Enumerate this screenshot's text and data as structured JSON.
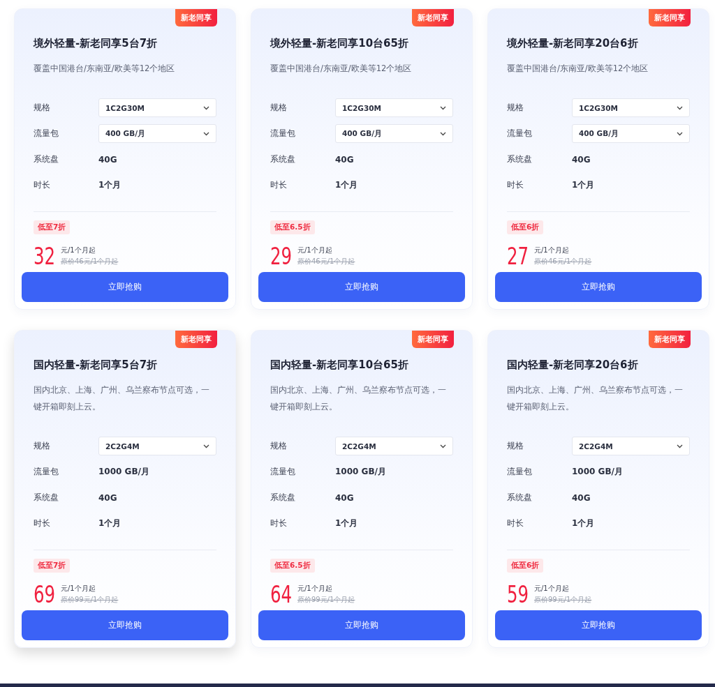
{
  "cards": [
    {
      "badge": "新老同享",
      "title": "境外轻量-新老同享5台7折",
      "description": "覆盖中国港台/东南亚/欧美等12个地区",
      "hovered": false,
      "specs": [
        {
          "label": "规格",
          "kind": "select",
          "value": "1C2G30M"
        },
        {
          "label": "流量包",
          "kind": "select",
          "value": "400 GB/月"
        },
        {
          "label": "系统盘",
          "kind": "text",
          "value": "40G"
        },
        {
          "label": "时长",
          "kind": "text",
          "value": "1个月"
        }
      ],
      "discount": "低至7折",
      "price": "32",
      "unit": "元/1个月起",
      "original": "原价46元/1个月起",
      "button": "立即抢购"
    },
    {
      "badge": "新老同享",
      "title": "境外轻量-新老同享10台65折",
      "description": "覆盖中国港台/东南亚/欧美等12个地区",
      "hovered": false,
      "specs": [
        {
          "label": "规格",
          "kind": "select",
          "value": "1C2G30M"
        },
        {
          "label": "流量包",
          "kind": "select",
          "value": "400 GB/月"
        },
        {
          "label": "系统盘",
          "kind": "text",
          "value": "40G"
        },
        {
          "label": "时长",
          "kind": "text",
          "value": "1个月"
        }
      ],
      "discount": "低至6.5折",
      "price": "29",
      "unit": "元/1个月起",
      "original": "原价46元/1个月起",
      "button": "立即抢购"
    },
    {
      "badge": "新老同享",
      "title": "境外轻量-新老同享20台6折",
      "description": "覆盖中国港台/东南亚/欧美等12个地区",
      "hovered": false,
      "specs": [
        {
          "label": "规格",
          "kind": "select",
          "value": "1C2G30M"
        },
        {
          "label": "流量包",
          "kind": "select",
          "value": "400 GB/月"
        },
        {
          "label": "系统盘",
          "kind": "text",
          "value": "40G"
        },
        {
          "label": "时长",
          "kind": "text",
          "value": "1个月"
        }
      ],
      "discount": "低至6折",
      "price": "27",
      "unit": "元/1个月起",
      "original": "原价46元/1个月起",
      "button": "立即抢购"
    },
    {
      "badge": "新老同享",
      "title": "国内轻量-新老同享5台7折",
      "description": "国内北京、上海、广州、乌兰察布节点可选，一键开箱即刻上云。",
      "hovered": true,
      "specs": [
        {
          "label": "规格",
          "kind": "select",
          "value": "2C2G4M"
        },
        {
          "label": "流量包",
          "kind": "text",
          "value": "1000 GB/月"
        },
        {
          "label": "系统盘",
          "kind": "text",
          "value": "40G"
        },
        {
          "label": "时长",
          "kind": "text",
          "value": "1个月"
        }
      ],
      "discount": "低至7折",
      "price": "69",
      "unit": "元/1个月起",
      "original": "原价99元/1个月起",
      "button": "立即抢购"
    },
    {
      "badge": "新老同享",
      "title": "国内轻量-新老同享10台65折",
      "description": "国内北京、上海、广州、乌兰察布节点可选，一键开箱即刻上云。",
      "hovered": false,
      "specs": [
        {
          "label": "规格",
          "kind": "select",
          "value": "2C2G4M"
        },
        {
          "label": "流量包",
          "kind": "text",
          "value": "1000 GB/月"
        },
        {
          "label": "系统盘",
          "kind": "text",
          "value": "40G"
        },
        {
          "label": "时长",
          "kind": "text",
          "value": "1个月"
        }
      ],
      "discount": "低至6.5折",
      "price": "64",
      "unit": "元/1个月起",
      "original": "原价99元/1个月起",
      "button": "立即抢购"
    },
    {
      "badge": "新老同享",
      "title": "国内轻量-新老同享20台6折",
      "description": "国内北京、上海、广州、乌兰察布节点可选，一键开箱即刻上云。",
      "hovered": false,
      "specs": [
        {
          "label": "规格",
          "kind": "select",
          "value": "2C2G4M"
        },
        {
          "label": "流量包",
          "kind": "text",
          "value": "1000 GB/月"
        },
        {
          "label": "系统盘",
          "kind": "text",
          "value": "40G"
        },
        {
          "label": "时长",
          "kind": "text",
          "value": "1个月"
        }
      ],
      "discount": "低至6折",
      "price": "59",
      "unit": "元/1个月起",
      "original": "原价99元/1个月起",
      "button": "立即抢购"
    }
  ]
}
